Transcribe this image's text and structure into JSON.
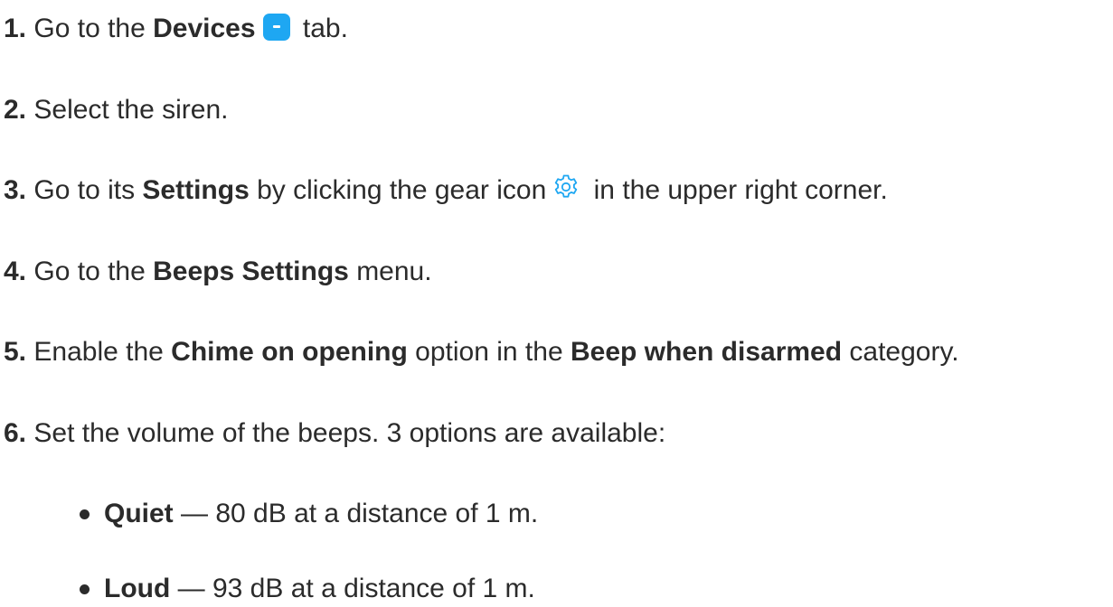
{
  "colors": {
    "text": "#2b2b2b",
    "accent": "#1ea7f2"
  },
  "icons": {
    "devices": "devices-tab-icon",
    "gear": "gear-icon"
  },
  "steps": [
    {
      "num": "1.",
      "pre": "Go to the ",
      "bold": "Devices",
      "post": " tab."
    },
    {
      "num": "2.",
      "text": "Select the siren."
    },
    {
      "num": "3.",
      "pre": "Go to its ",
      "bold": "Settings",
      "mid": " by clicking the gear icon",
      "post": " in the upper right corner."
    },
    {
      "num": "4.",
      "pre": "Go to the ",
      "bold": "Beeps Settings",
      "post": " menu."
    },
    {
      "num": "5.",
      "pre": "Enable the ",
      "bold1": "Chime on opening",
      "mid": " option in the ",
      "bold2": "Beep when disarmed",
      "post": " category."
    },
    {
      "num": "6.",
      "text": "Set the volume of the beeps. 3 options are available:"
    }
  ],
  "options": [
    {
      "label": "Quiet",
      "text": " — 80 dB at a distance of 1 m."
    },
    {
      "label": "Loud",
      "text": " — 93 dB at a distance of 1 m."
    }
  ]
}
